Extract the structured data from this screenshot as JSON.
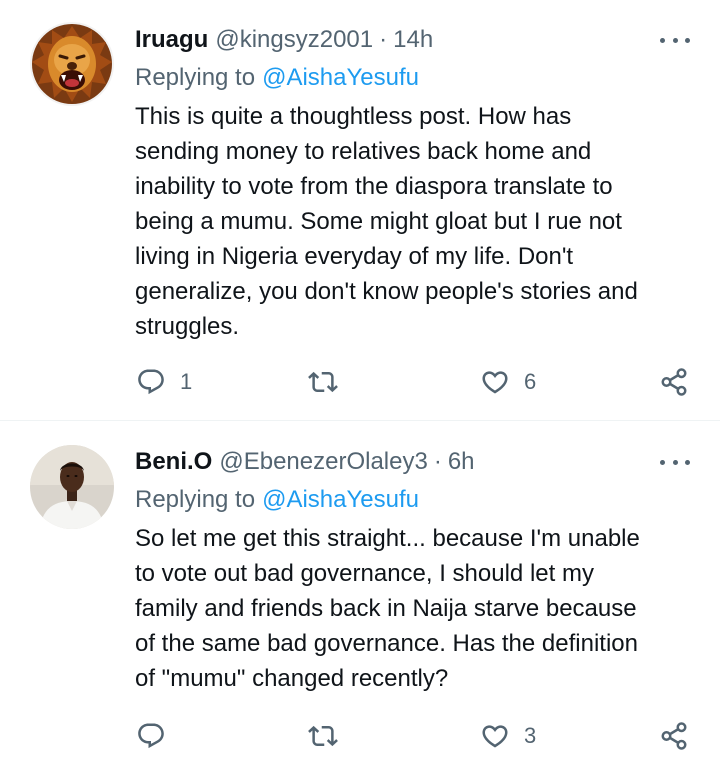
{
  "tweets": [
    {
      "name": "Iruagu",
      "handle": "@kingsyz2001",
      "separator": "·",
      "time": "14h",
      "replying_prefix": "Replying to",
      "replying_to": "@AishaYesufu",
      "text": "This is quite a thoughtless post. How has\nsending money to relatives back home and\ninability to vote from the diaspora translate to\nbeing a mumu. Some might gloat but I rue not\nliving in Nigeria everyday of my life. Don't\ngeneralize, you don't know people's stories and\nstruggles.",
      "reply_count": "1",
      "retweet_count": "",
      "like_count": "6",
      "avatar_icon": "lion-avatar"
    },
    {
      "name": "Beni.O",
      "handle": "@EbenezerOlaley3",
      "separator": "·",
      "time": "6h",
      "replying_prefix": "Replying to",
      "replying_to": "@AishaYesufu",
      "text": "So let me get this straight... because I'm unable\nto vote out bad governance, I should let my\nfamily and friends back in Naija starve because\nof the same bad governance. Has the definition\nof \"mumu\" changed recently?",
      "reply_count": "",
      "retweet_count": "",
      "like_count": "3",
      "avatar_icon": "person-avatar"
    }
  ],
  "colors": {
    "text_primary": "#0f1419",
    "text_secondary": "#536471",
    "link": "#1d9bf0",
    "divider": "#eff3f4"
  },
  "icons": [
    "reply-icon",
    "retweet-icon",
    "like-icon",
    "share-icon",
    "more-options-icon"
  ]
}
